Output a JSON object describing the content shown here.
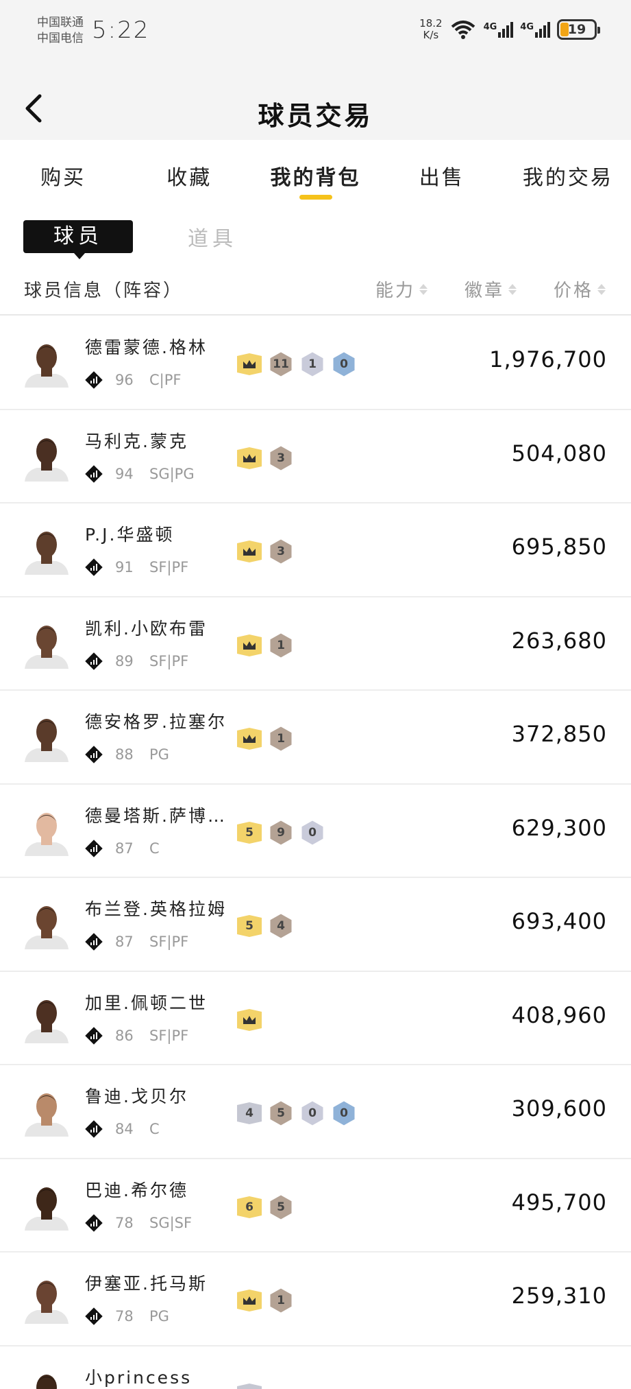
{
  "status_bar": {
    "carrier1": "中国联通",
    "carrier2": "中国电信",
    "time": "5:22",
    "net_speed_value": "18.2",
    "net_speed_unit": "K/s",
    "signal1": "4G",
    "signal2": "4G",
    "battery": "19"
  },
  "header": {
    "title": "球员交易"
  },
  "tabs": [
    "购买",
    "收藏",
    "我的背包",
    "出售",
    "我的交易"
  ],
  "active_tab": 2,
  "subtabs": {
    "player": "球员",
    "item": "道具"
  },
  "columns": {
    "info": "球员信息（阵容）",
    "ability": "能力",
    "badge": "徽章",
    "price": "价格"
  },
  "colors": {
    "accent": "#f5c21b",
    "gold": "#f3d36a",
    "bronze": "#b4a294",
    "silver": "#c7c9d6",
    "blue": "#93b6d9"
  },
  "players": [
    {
      "name": "德雷蒙德.格林",
      "rating": "96",
      "pos": "C|PF",
      "price": "1,976,700",
      "skin": "#5a3a28",
      "badges": [
        {
          "t": "crown",
          "v": ""
        },
        {
          "t": "bronze",
          "v": "11"
        },
        {
          "t": "silver",
          "v": "1"
        },
        {
          "t": "blue",
          "v": "0"
        }
      ]
    },
    {
      "name": "马利克.蒙克",
      "rating": "94",
      "pos": "SG|PG",
      "price": "504,080",
      "skin": "#4a2f22",
      "badges": [
        {
          "t": "crown",
          "v": ""
        },
        {
          "t": "bronze",
          "v": "3"
        }
      ]
    },
    {
      "name": "P.J.华盛顿",
      "rating": "91",
      "pos": "SF|PF",
      "price": "695,850",
      "skin": "#5e3e2c",
      "badges": [
        {
          "t": "crown",
          "v": ""
        },
        {
          "t": "bronze",
          "v": "3"
        }
      ]
    },
    {
      "name": "凯利.小欧布雷",
      "rating": "89",
      "pos": "SF|PF",
      "price": "263,680",
      "skin": "#6a4632",
      "badges": [
        {
          "t": "crown",
          "v": ""
        },
        {
          "t": "bronze",
          "v": "1"
        }
      ]
    },
    {
      "name": "德安格罗.拉塞尔",
      "rating": "88",
      "pos": "PG",
      "price": "372,850",
      "skin": "#5a3b2a",
      "badges": [
        {
          "t": "crown",
          "v": ""
        },
        {
          "t": "bronze",
          "v": "1"
        }
      ]
    },
    {
      "name": "德曼塔斯.萨博…",
      "rating": "87",
      "pos": "C",
      "price": "629,300",
      "skin": "#e2b9a0",
      "badges": [
        {
          "t": "gold",
          "v": "5"
        },
        {
          "t": "bronze",
          "v": "9"
        },
        {
          "t": "silver",
          "v": "0"
        }
      ]
    },
    {
      "name": "布兰登.英格拉姆",
      "rating": "87",
      "pos": "SF|PF",
      "price": "693,400",
      "skin": "#6b4530",
      "badges": [
        {
          "t": "gold",
          "v": "5"
        },
        {
          "t": "bronze",
          "v": "4"
        }
      ]
    },
    {
      "name": "加里.佩顿二世",
      "rating": "86",
      "pos": "SF|PF",
      "price": "408,960",
      "skin": "#4d3022",
      "badges": [
        {
          "t": "crown",
          "v": ""
        }
      ]
    },
    {
      "name": "鲁迪.戈贝尔",
      "rating": "84",
      "pos": "C",
      "price": "309,600",
      "skin": "#b98a6a",
      "badges": [
        {
          "t": "silvergray",
          "v": "4"
        },
        {
          "t": "bronze",
          "v": "5"
        },
        {
          "t": "silver",
          "v": "0"
        },
        {
          "t": "blue",
          "v": "0"
        }
      ]
    },
    {
      "name": "巴迪.希尔德",
      "rating": "78",
      "pos": "SG|SF",
      "price": "495,700",
      "skin": "#3e2719",
      "badges": [
        {
          "t": "gold",
          "v": "6"
        },
        {
          "t": "bronze",
          "v": "5"
        }
      ]
    },
    {
      "name": "伊塞亚.托马斯",
      "rating": "78",
      "pos": "PG",
      "price": "259,310",
      "skin": "#6a4432",
      "badges": [
        {
          "t": "crown",
          "v": ""
        },
        {
          "t": "bronze",
          "v": "1"
        }
      ]
    },
    {
      "name": "小princess",
      "rating": "",
      "pos": "",
      "price": "",
      "skin": "#3e2719",
      "badges": [
        {
          "t": "silvergray",
          "v": ""
        }
      ]
    }
  ]
}
